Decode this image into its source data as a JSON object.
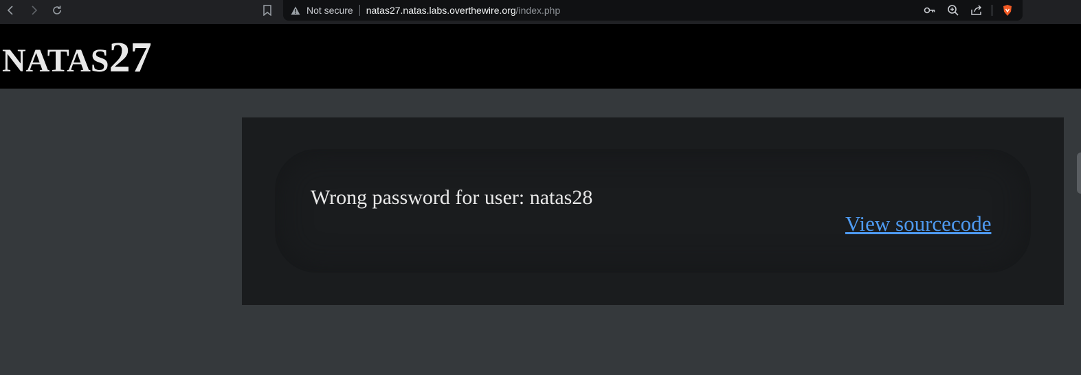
{
  "browser": {
    "security_label": "Not secure",
    "url_host": "natas27.natas.labs.overthewire.org",
    "url_path": "/index.php"
  },
  "header": {
    "title_prefix": "NATAS",
    "title_number": "27"
  },
  "main": {
    "message": "Wrong password for user: natas28",
    "source_link": "View sourcecode"
  },
  "colors": {
    "page_bg": "#35393c",
    "header_bg": "#000000",
    "content_bg": "#1a1c1e",
    "link": "#4e9af1"
  }
}
